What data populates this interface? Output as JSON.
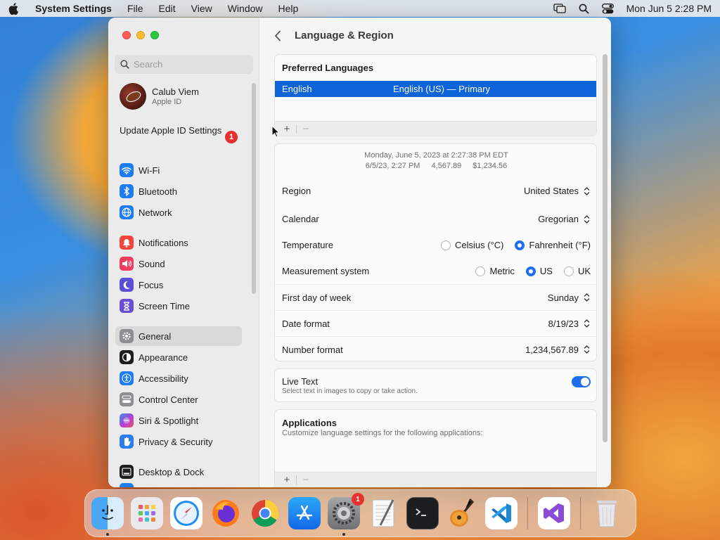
{
  "menubar": {
    "app_name": "System Settings",
    "menus": [
      "File",
      "Edit",
      "View",
      "Window",
      "Help"
    ],
    "clock": "Mon Jun 5  2:28 PM"
  },
  "sidebar": {
    "search_placeholder": "Search",
    "account_name": "Calub Viem",
    "account_sub": "Apple ID",
    "update_label": "Update Apple ID Settings",
    "update_badge": "1",
    "items": [
      {
        "label": "Wi-Fi",
        "icon": "wifi-icon",
        "color": "#1e7cf2"
      },
      {
        "label": "Bluetooth",
        "icon": "bluetooth-icon",
        "color": "#1e7cf2"
      },
      {
        "label": "Network",
        "icon": "globe-icon",
        "color": "#1e7cf2"
      },
      {
        "label": "Notifications",
        "icon": "bell-icon",
        "color": "#f0463c"
      },
      {
        "label": "Sound",
        "icon": "speaker-icon",
        "color": "#ef3d62"
      },
      {
        "label": "Focus",
        "icon": "moon-icon",
        "color": "#5b4fd6"
      },
      {
        "label": "Screen Time",
        "icon": "hourglass-icon",
        "color": "#6a4fd6"
      },
      {
        "label": "General",
        "icon": "gear-icon",
        "color": "#8e8e93",
        "selected": true
      },
      {
        "label": "Appearance",
        "icon": "appearance-icon",
        "color": "#1d1d1f"
      },
      {
        "label": "Accessibility",
        "icon": "accessibility-icon",
        "color": "#1e7cf2"
      },
      {
        "label": "Control Center",
        "icon": "control-center-icon",
        "color": "#8e8e93"
      },
      {
        "label": "Siri & Spotlight",
        "icon": "siri-icon",
        "color": "#a33fd1"
      },
      {
        "label": "Privacy & Security",
        "icon": "hand-icon",
        "color": "#2f7ef0"
      },
      {
        "label": "Desktop & Dock",
        "icon": "dock-icon",
        "color": "#1d1d1f"
      }
    ]
  },
  "main": {
    "title": "Language & Region",
    "preferred_languages": {
      "heading": "Preferred Languages",
      "language": "English",
      "language_detail": "English (US) — Primary"
    },
    "preview": {
      "line1": "Monday, June 5, 2023 at 2:27:38 PM EDT",
      "line2_date": "6/5/23, 2:27 PM",
      "line2_number": "4,567.89",
      "line2_currency": "$1,234.56"
    },
    "rows": {
      "region_label": "Region",
      "region_value": "United States",
      "calendar_label": "Calendar",
      "calendar_value": "Gregorian",
      "temperature_label": "Temperature",
      "temp_opt1": "Celsius (°C)",
      "temp_opt2": "Fahrenheit (°F)",
      "measure_label": "Measurement system",
      "measure_opt1": "Metric",
      "measure_opt2": "US",
      "measure_opt3": "UK",
      "week_label": "First day of week",
      "week_value": "Sunday",
      "date_label": "Date format",
      "date_value": "8/19/23",
      "number_label": "Number format",
      "number_value": "1,234,567.89"
    },
    "selected": {
      "temperature": "Fahrenheit (°F)",
      "measurement": "US"
    },
    "live_text": {
      "label": "Live Text",
      "desc": "Select text in images to copy or take action.",
      "enabled": true
    },
    "applications": {
      "heading": "Applications",
      "desc": "Customize language settings for the following applications:"
    },
    "add": "+",
    "remove": "−"
  },
  "dock": {
    "apps": [
      "Finder",
      "Launchpad",
      "Safari",
      "Firefox",
      "Chrome",
      "App Store",
      "System Settings",
      "TextEdit",
      "Terminal",
      "GarageBand",
      "Visual Studio Code",
      "Visual Studio",
      "Trash"
    ],
    "settings_badge": "1"
  }
}
